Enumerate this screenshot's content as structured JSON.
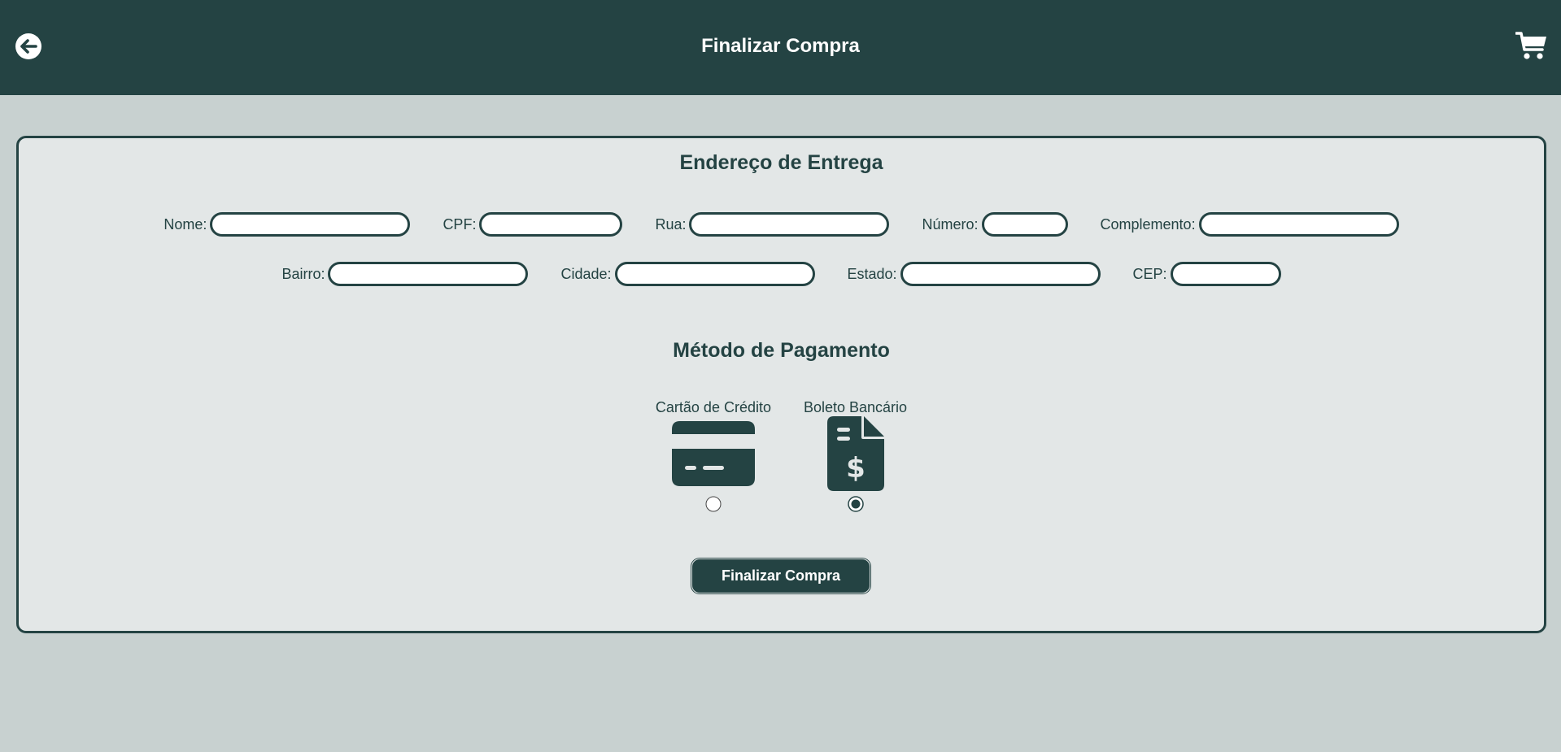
{
  "header": {
    "title": "Finalizar Compra",
    "back_icon": "arrow-left-circle-icon",
    "cart_icon": "shopping-cart-icon",
    "background": "#244343"
  },
  "address": {
    "title": "Endereço de Entrega",
    "fields": {
      "nome": {
        "label": "Nome:",
        "value": ""
      },
      "cpf": {
        "label": "CPF:",
        "value": ""
      },
      "rua": {
        "label": "Rua:",
        "value": ""
      },
      "numero": {
        "label": "Número:",
        "value": ""
      },
      "complemento": {
        "label": "Complemento:",
        "value": ""
      },
      "bairro": {
        "label": "Bairro:",
        "value": ""
      },
      "cidade": {
        "label": "Cidade:",
        "value": ""
      },
      "estado": {
        "label": "Estado:",
        "value": ""
      },
      "cep": {
        "label": "CEP:",
        "value": ""
      }
    }
  },
  "payment": {
    "title": "Método de Pagamento",
    "options": [
      {
        "label": "Cartão de Crédito",
        "icon": "credit-card-icon",
        "selected": false
      },
      {
        "label": "Boleto Bancário",
        "icon": "invoice-dollar-icon",
        "selected": true
      }
    ]
  },
  "submit": {
    "label": "Finalizar Compra"
  },
  "colors": {
    "primary": "#244343",
    "page_background": "#c8d1d0",
    "card_background": "#e3e7e7"
  }
}
